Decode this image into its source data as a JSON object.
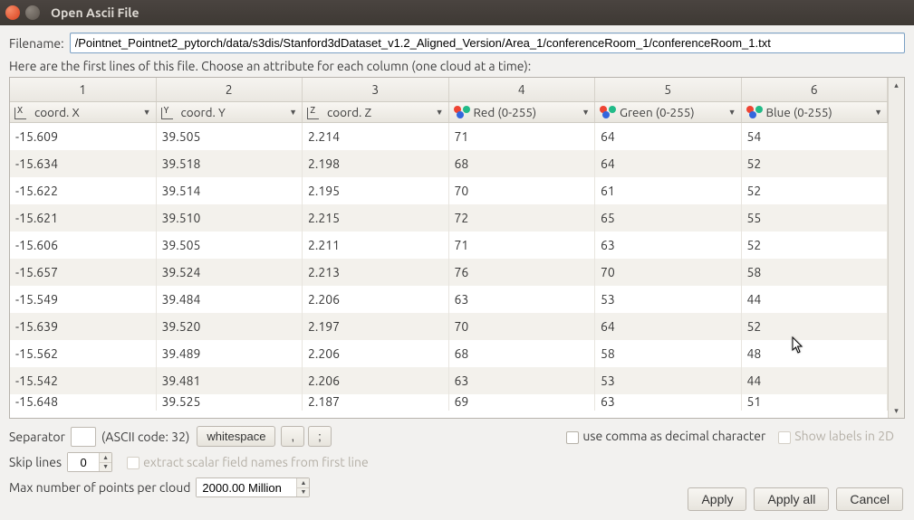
{
  "window": {
    "title": "Open Ascii File"
  },
  "filename": {
    "label": "Filename:",
    "value": "/Pointnet_Pointnet2_pytorch/data/s3dis/Stanford3dDataset_v1.2_Aligned_Version/Area_1/conferenceRoom_1/conferenceRoom_1.txt"
  },
  "instruction": "Here are the first lines of this file. Choose an attribute for each column (one cloud at a time):",
  "columns": {
    "headers": [
      "1",
      "2",
      "3",
      "4",
      "5",
      "6"
    ],
    "selectors": [
      {
        "icon": "axis-x",
        "label": "coord. X"
      },
      {
        "icon": "axis-y",
        "label": "coord. Y"
      },
      {
        "icon": "axis-z",
        "label": "coord. Z"
      },
      {
        "icon": "rgb",
        "label": "Red (0-255)"
      },
      {
        "icon": "rgb",
        "label": "Green (0-255)"
      },
      {
        "icon": "rgb",
        "label": "Blue (0-255)"
      }
    ]
  },
  "rows": [
    [
      "-15.609",
      "39.505",
      "2.214",
      "71",
      "64",
      "54"
    ],
    [
      "-15.634",
      "39.518",
      "2.198",
      "68",
      "64",
      "52"
    ],
    [
      "-15.622",
      "39.514",
      "2.195",
      "70",
      "61",
      "52"
    ],
    [
      "-15.621",
      "39.510",
      "2.215",
      "72",
      "65",
      "55"
    ],
    [
      "-15.606",
      "39.505",
      "2.211",
      "71",
      "63",
      "52"
    ],
    [
      "-15.657",
      "39.524",
      "2.213",
      "76",
      "70",
      "58"
    ],
    [
      "-15.549",
      "39.484",
      "2.206",
      "63",
      "53",
      "44"
    ],
    [
      "-15.639",
      "39.520",
      "2.197",
      "70",
      "64",
      "52"
    ],
    [
      "-15.562",
      "39.489",
      "2.206",
      "68",
      "58",
      "48"
    ],
    [
      "-15.542",
      "39.481",
      "2.206",
      "63",
      "53",
      "44"
    ],
    [
      "-15.648",
      "39.525",
      "2.187",
      "69",
      "63",
      "51"
    ]
  ],
  "separator": {
    "label": "Separator",
    "value": "",
    "ascii_label": "(ASCII code: 32)",
    "whitespace_btn": "whitespace",
    "comma_btn": ",",
    "semicolon_btn": ";",
    "comma_decimal": "use comma as decimal character",
    "show_labels": "Show labels in 2D"
  },
  "skip": {
    "label": "Skip lines",
    "value": "0",
    "extract": "extract scalar field names from first line"
  },
  "maxpoints": {
    "label": "Max number of points per cloud",
    "value": "2000.00 Million"
  },
  "buttons": {
    "apply": "Apply",
    "apply_all": "Apply all",
    "cancel": "Cancel"
  }
}
